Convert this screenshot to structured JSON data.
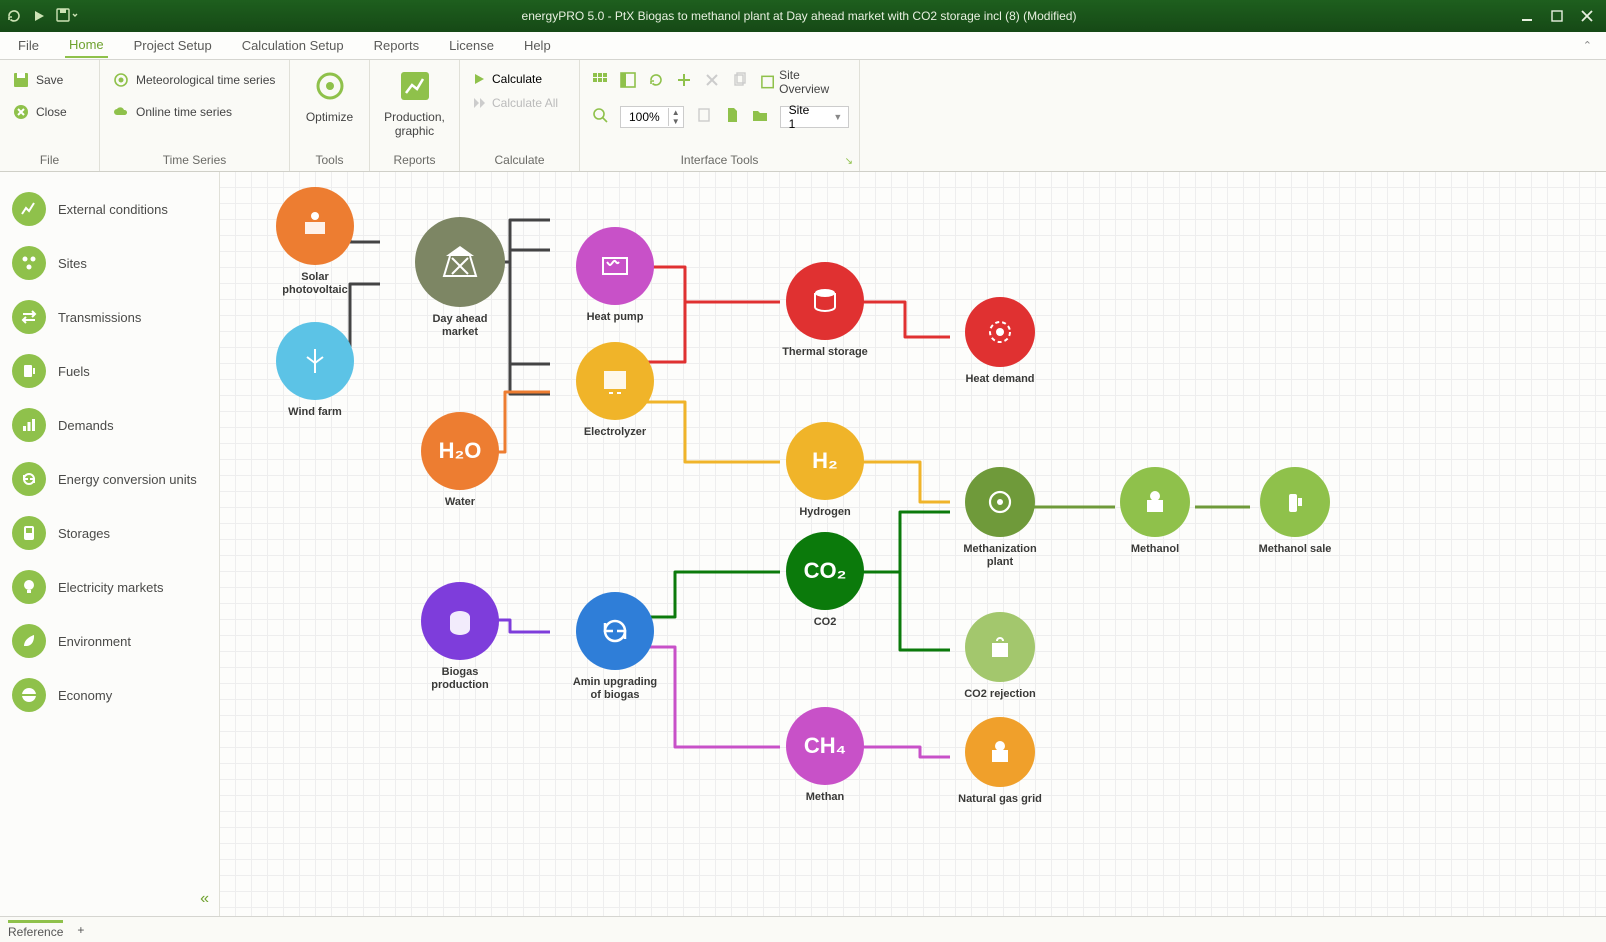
{
  "window": {
    "title": "energyPRO 5.0  -  PtX Biogas to methanol plant at Day ahead market with CO2 storage incl (8) (Modified)"
  },
  "menu": {
    "tabs": [
      "File",
      "Home",
      "Project Setup",
      "Calculation Setup",
      "Reports",
      "License",
      "Help"
    ],
    "active": "Home"
  },
  "ribbon": {
    "file": {
      "save": "Save",
      "close": "Close",
      "group": "File"
    },
    "timeseries": {
      "met": "Meteorological time series",
      "online": "Online time series",
      "group": "Time Series"
    },
    "tools": {
      "optimize": "Optimize",
      "group": "Tools"
    },
    "reports": {
      "prodgfx_l1": "Production,",
      "prodgfx_l2": "graphic",
      "group": "Reports"
    },
    "calculate": {
      "calc": "Calculate",
      "calc_all": "Calculate All",
      "group": "Calculate"
    },
    "interface": {
      "zoom": "100%",
      "site_overview": "Site Overview",
      "site_selected": "Site 1",
      "group": "Interface Tools"
    }
  },
  "sidebar": {
    "items": [
      {
        "label": "External conditions"
      },
      {
        "label": "Sites"
      },
      {
        "label": "Transmissions"
      },
      {
        "label": "Fuels"
      },
      {
        "label": "Demands"
      },
      {
        "label": "Energy conversion units"
      },
      {
        "label": "Storages"
      },
      {
        "label": "Electricity markets"
      },
      {
        "label": "Environment"
      },
      {
        "label": "Economy"
      }
    ]
  },
  "nodes": {
    "solar": {
      "label": "Solar\nphotovoltaic",
      "color": "#ed7d31"
    },
    "wind": {
      "label": "Wind farm",
      "color": "#5cc3e6"
    },
    "market": {
      "label": "Day ahead\nmarket",
      "color": "#7d8664"
    },
    "water": {
      "label": "Water",
      "text": "H₂O",
      "color": "#ed7d31"
    },
    "heatpump": {
      "label": "Heat pump",
      "color": "#c851c8"
    },
    "electrolyzer": {
      "label": "Electrolyzer",
      "color": "#f0b429"
    },
    "biogas": {
      "label": "Biogas\nproduction",
      "color": "#7e3ddb"
    },
    "amin": {
      "label": "Amin upgrading\nof biogas",
      "color": "#2f7ed8"
    },
    "thermal": {
      "label": "Thermal storage",
      "color": "#e03131"
    },
    "heatdemand": {
      "label": "Heat demand",
      "color": "#e03131"
    },
    "h2": {
      "label": "Hydrogen",
      "text": "H₂",
      "color": "#f0b429"
    },
    "co2": {
      "label": "CO2",
      "text": "CO₂",
      "color": "#0b7a0b"
    },
    "ch4": {
      "label": "Methan",
      "text": "CH₄",
      "color": "#c851c8"
    },
    "methplant": {
      "label": "Methanization\nplant",
      "color": "#6f9a3a"
    },
    "methanol": {
      "label": "Methanol",
      "color": "#8fc14b"
    },
    "methsale": {
      "label": "Methanol sale",
      "color": "#8fc14b"
    },
    "co2rej": {
      "label": "CO2 rejection",
      "color": "#a3c76d"
    },
    "natgas": {
      "label": "Natural gas grid",
      "color": "#f0a02b"
    }
  },
  "status": {
    "reference": "Reference",
    "plus": "+"
  }
}
